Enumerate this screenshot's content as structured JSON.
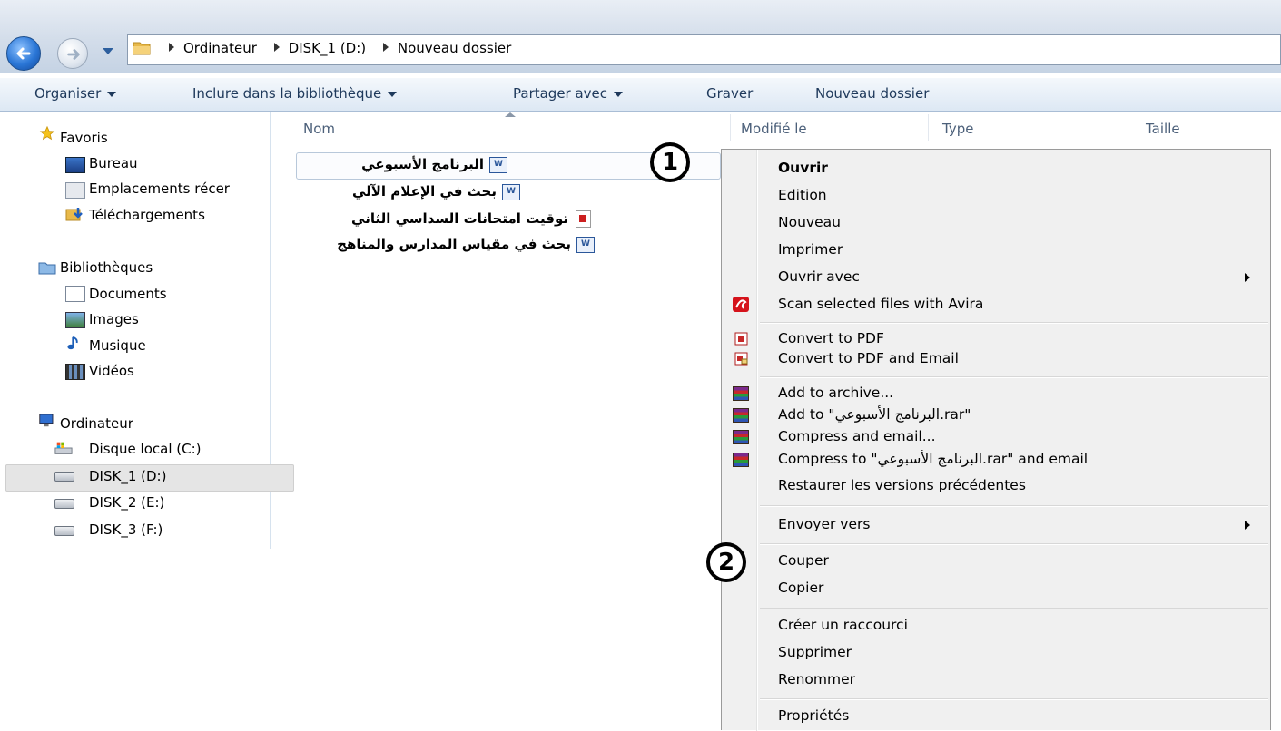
{
  "address": {
    "crumbs": [
      "Ordinateur",
      "DISK_1 (D:)",
      "Nouveau dossier"
    ]
  },
  "toolbar": {
    "organise": "Organiser",
    "include": "Inclure dans la bibliothèque",
    "share": "Partager avec",
    "burn": "Graver",
    "new_folder": "Nouveau dossier"
  },
  "nav": {
    "favorites": "Favoris",
    "desktop": "Bureau",
    "recent": "Emplacements récer",
    "downloads": "Téléchargements",
    "libraries": "Bibliothèques",
    "documents": "Documents",
    "images": "Images",
    "music": "Musique",
    "videos": "Vidéos",
    "computer": "Ordinateur",
    "disk_c": "Disque local (C:)",
    "disk_d": "DISK_1 (D:)",
    "disk_e": "DISK_2 (E:)",
    "disk_f": "DISK_3 (F:)"
  },
  "columns": {
    "name": "Nom",
    "modified": "Modifié le",
    "type": "Type",
    "size": "Taille"
  },
  "files": [
    "البرنامج الأسبوعي",
    "بحث في الإعلام الآلي",
    "توقيت امتحانات السداسي الثاني",
    "بحث في مقياس المدارس والمناهج"
  ],
  "callouts": {
    "one": "1",
    "two": "2"
  },
  "context_menu": {
    "open": "Ouvrir",
    "edit": "Edition",
    "new": "Nouveau",
    "print": "Imprimer",
    "open_with": "Ouvrir avec",
    "avira": "Scan selected files with Avira",
    "to_pdf": "Convert to PDF",
    "to_pdf_email": "Convert to PDF and Email",
    "add_archive": "Add to archive...",
    "add_to_rar": "Add to \"البرنامج الأسبوعي.rar\"",
    "compress_email": "Compress and email...",
    "compress_to_rar_email": "Compress to \"البرنامج الأسبوعي.rar\" and email",
    "restore": "Restaurer les versions précédentes",
    "send_to": "Envoyer vers",
    "cut": "Couper",
    "copy": "Copier",
    "shortcut": "Créer un raccourci",
    "delete": "Supprimer",
    "rename": "Renommer",
    "properties": "Propriétés"
  },
  "colors": {
    "toolbar_text": "#1e395b",
    "avira_red": "#d5131b",
    "menu_bg": "#f0f0f0"
  }
}
